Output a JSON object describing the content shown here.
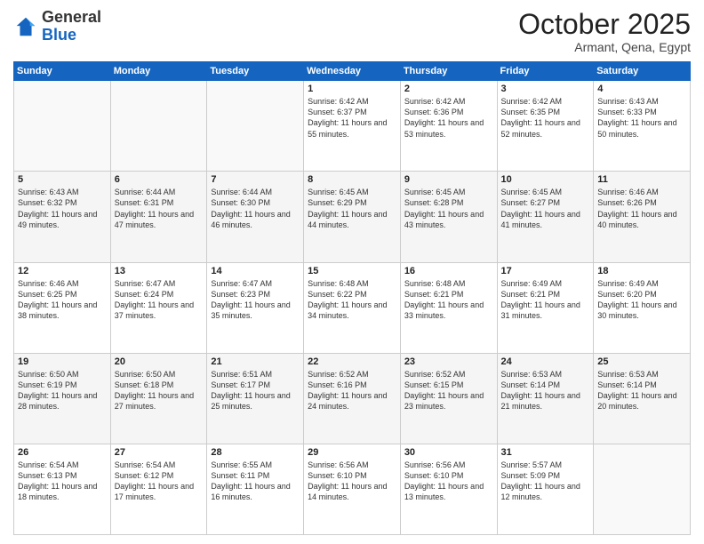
{
  "logo": {
    "general": "General",
    "blue": "Blue"
  },
  "header": {
    "month": "October 2025",
    "location": "Armant, Qena, Egypt"
  },
  "days_of_week": [
    "Sunday",
    "Monday",
    "Tuesday",
    "Wednesday",
    "Thursday",
    "Friday",
    "Saturday"
  ],
  "weeks": [
    [
      {
        "day": "",
        "sunrise": "",
        "sunset": "",
        "daylight": ""
      },
      {
        "day": "",
        "sunrise": "",
        "sunset": "",
        "daylight": ""
      },
      {
        "day": "",
        "sunrise": "",
        "sunset": "",
        "daylight": ""
      },
      {
        "day": "1",
        "sunrise": "Sunrise: 6:42 AM",
        "sunset": "Sunset: 6:37 PM",
        "daylight": "Daylight: 11 hours and 55 minutes."
      },
      {
        "day": "2",
        "sunrise": "Sunrise: 6:42 AM",
        "sunset": "Sunset: 6:36 PM",
        "daylight": "Daylight: 11 hours and 53 minutes."
      },
      {
        "day": "3",
        "sunrise": "Sunrise: 6:42 AM",
        "sunset": "Sunset: 6:35 PM",
        "daylight": "Daylight: 11 hours and 52 minutes."
      },
      {
        "day": "4",
        "sunrise": "Sunrise: 6:43 AM",
        "sunset": "Sunset: 6:33 PM",
        "daylight": "Daylight: 11 hours and 50 minutes."
      }
    ],
    [
      {
        "day": "5",
        "sunrise": "Sunrise: 6:43 AM",
        "sunset": "Sunset: 6:32 PM",
        "daylight": "Daylight: 11 hours and 49 minutes."
      },
      {
        "day": "6",
        "sunrise": "Sunrise: 6:44 AM",
        "sunset": "Sunset: 6:31 PM",
        "daylight": "Daylight: 11 hours and 47 minutes."
      },
      {
        "day": "7",
        "sunrise": "Sunrise: 6:44 AM",
        "sunset": "Sunset: 6:30 PM",
        "daylight": "Daylight: 11 hours and 46 minutes."
      },
      {
        "day": "8",
        "sunrise": "Sunrise: 6:45 AM",
        "sunset": "Sunset: 6:29 PM",
        "daylight": "Daylight: 11 hours and 44 minutes."
      },
      {
        "day": "9",
        "sunrise": "Sunrise: 6:45 AM",
        "sunset": "Sunset: 6:28 PM",
        "daylight": "Daylight: 11 hours and 43 minutes."
      },
      {
        "day": "10",
        "sunrise": "Sunrise: 6:45 AM",
        "sunset": "Sunset: 6:27 PM",
        "daylight": "Daylight: 11 hours and 41 minutes."
      },
      {
        "day": "11",
        "sunrise": "Sunrise: 6:46 AM",
        "sunset": "Sunset: 6:26 PM",
        "daylight": "Daylight: 11 hours and 40 minutes."
      }
    ],
    [
      {
        "day": "12",
        "sunrise": "Sunrise: 6:46 AM",
        "sunset": "Sunset: 6:25 PM",
        "daylight": "Daylight: 11 hours and 38 minutes."
      },
      {
        "day": "13",
        "sunrise": "Sunrise: 6:47 AM",
        "sunset": "Sunset: 6:24 PM",
        "daylight": "Daylight: 11 hours and 37 minutes."
      },
      {
        "day": "14",
        "sunrise": "Sunrise: 6:47 AM",
        "sunset": "Sunset: 6:23 PM",
        "daylight": "Daylight: 11 hours and 35 minutes."
      },
      {
        "day": "15",
        "sunrise": "Sunrise: 6:48 AM",
        "sunset": "Sunset: 6:22 PM",
        "daylight": "Daylight: 11 hours and 34 minutes."
      },
      {
        "day": "16",
        "sunrise": "Sunrise: 6:48 AM",
        "sunset": "Sunset: 6:21 PM",
        "daylight": "Daylight: 11 hours and 33 minutes."
      },
      {
        "day": "17",
        "sunrise": "Sunrise: 6:49 AM",
        "sunset": "Sunset: 6:21 PM",
        "daylight": "Daylight: 11 hours and 31 minutes."
      },
      {
        "day": "18",
        "sunrise": "Sunrise: 6:49 AM",
        "sunset": "Sunset: 6:20 PM",
        "daylight": "Daylight: 11 hours and 30 minutes."
      }
    ],
    [
      {
        "day": "19",
        "sunrise": "Sunrise: 6:50 AM",
        "sunset": "Sunset: 6:19 PM",
        "daylight": "Daylight: 11 hours and 28 minutes."
      },
      {
        "day": "20",
        "sunrise": "Sunrise: 6:50 AM",
        "sunset": "Sunset: 6:18 PM",
        "daylight": "Daylight: 11 hours and 27 minutes."
      },
      {
        "day": "21",
        "sunrise": "Sunrise: 6:51 AM",
        "sunset": "Sunset: 6:17 PM",
        "daylight": "Daylight: 11 hours and 25 minutes."
      },
      {
        "day": "22",
        "sunrise": "Sunrise: 6:52 AM",
        "sunset": "Sunset: 6:16 PM",
        "daylight": "Daylight: 11 hours and 24 minutes."
      },
      {
        "day": "23",
        "sunrise": "Sunrise: 6:52 AM",
        "sunset": "Sunset: 6:15 PM",
        "daylight": "Daylight: 11 hours and 23 minutes."
      },
      {
        "day": "24",
        "sunrise": "Sunrise: 6:53 AM",
        "sunset": "Sunset: 6:14 PM",
        "daylight": "Daylight: 11 hours and 21 minutes."
      },
      {
        "day": "25",
        "sunrise": "Sunrise: 6:53 AM",
        "sunset": "Sunset: 6:14 PM",
        "daylight": "Daylight: 11 hours and 20 minutes."
      }
    ],
    [
      {
        "day": "26",
        "sunrise": "Sunrise: 6:54 AM",
        "sunset": "Sunset: 6:13 PM",
        "daylight": "Daylight: 11 hours and 18 minutes."
      },
      {
        "day": "27",
        "sunrise": "Sunrise: 6:54 AM",
        "sunset": "Sunset: 6:12 PM",
        "daylight": "Daylight: 11 hours and 17 minutes."
      },
      {
        "day": "28",
        "sunrise": "Sunrise: 6:55 AM",
        "sunset": "Sunset: 6:11 PM",
        "daylight": "Daylight: 11 hours and 16 minutes."
      },
      {
        "day": "29",
        "sunrise": "Sunrise: 6:56 AM",
        "sunset": "Sunset: 6:10 PM",
        "daylight": "Daylight: 11 hours and 14 minutes."
      },
      {
        "day": "30",
        "sunrise": "Sunrise: 6:56 AM",
        "sunset": "Sunset: 6:10 PM",
        "daylight": "Daylight: 11 hours and 13 minutes."
      },
      {
        "day": "31",
        "sunrise": "Sunrise: 5:57 AM",
        "sunset": "Sunset: 5:09 PM",
        "daylight": "Daylight: 11 hours and 12 minutes."
      },
      {
        "day": "",
        "sunrise": "",
        "sunset": "",
        "daylight": ""
      }
    ]
  ]
}
